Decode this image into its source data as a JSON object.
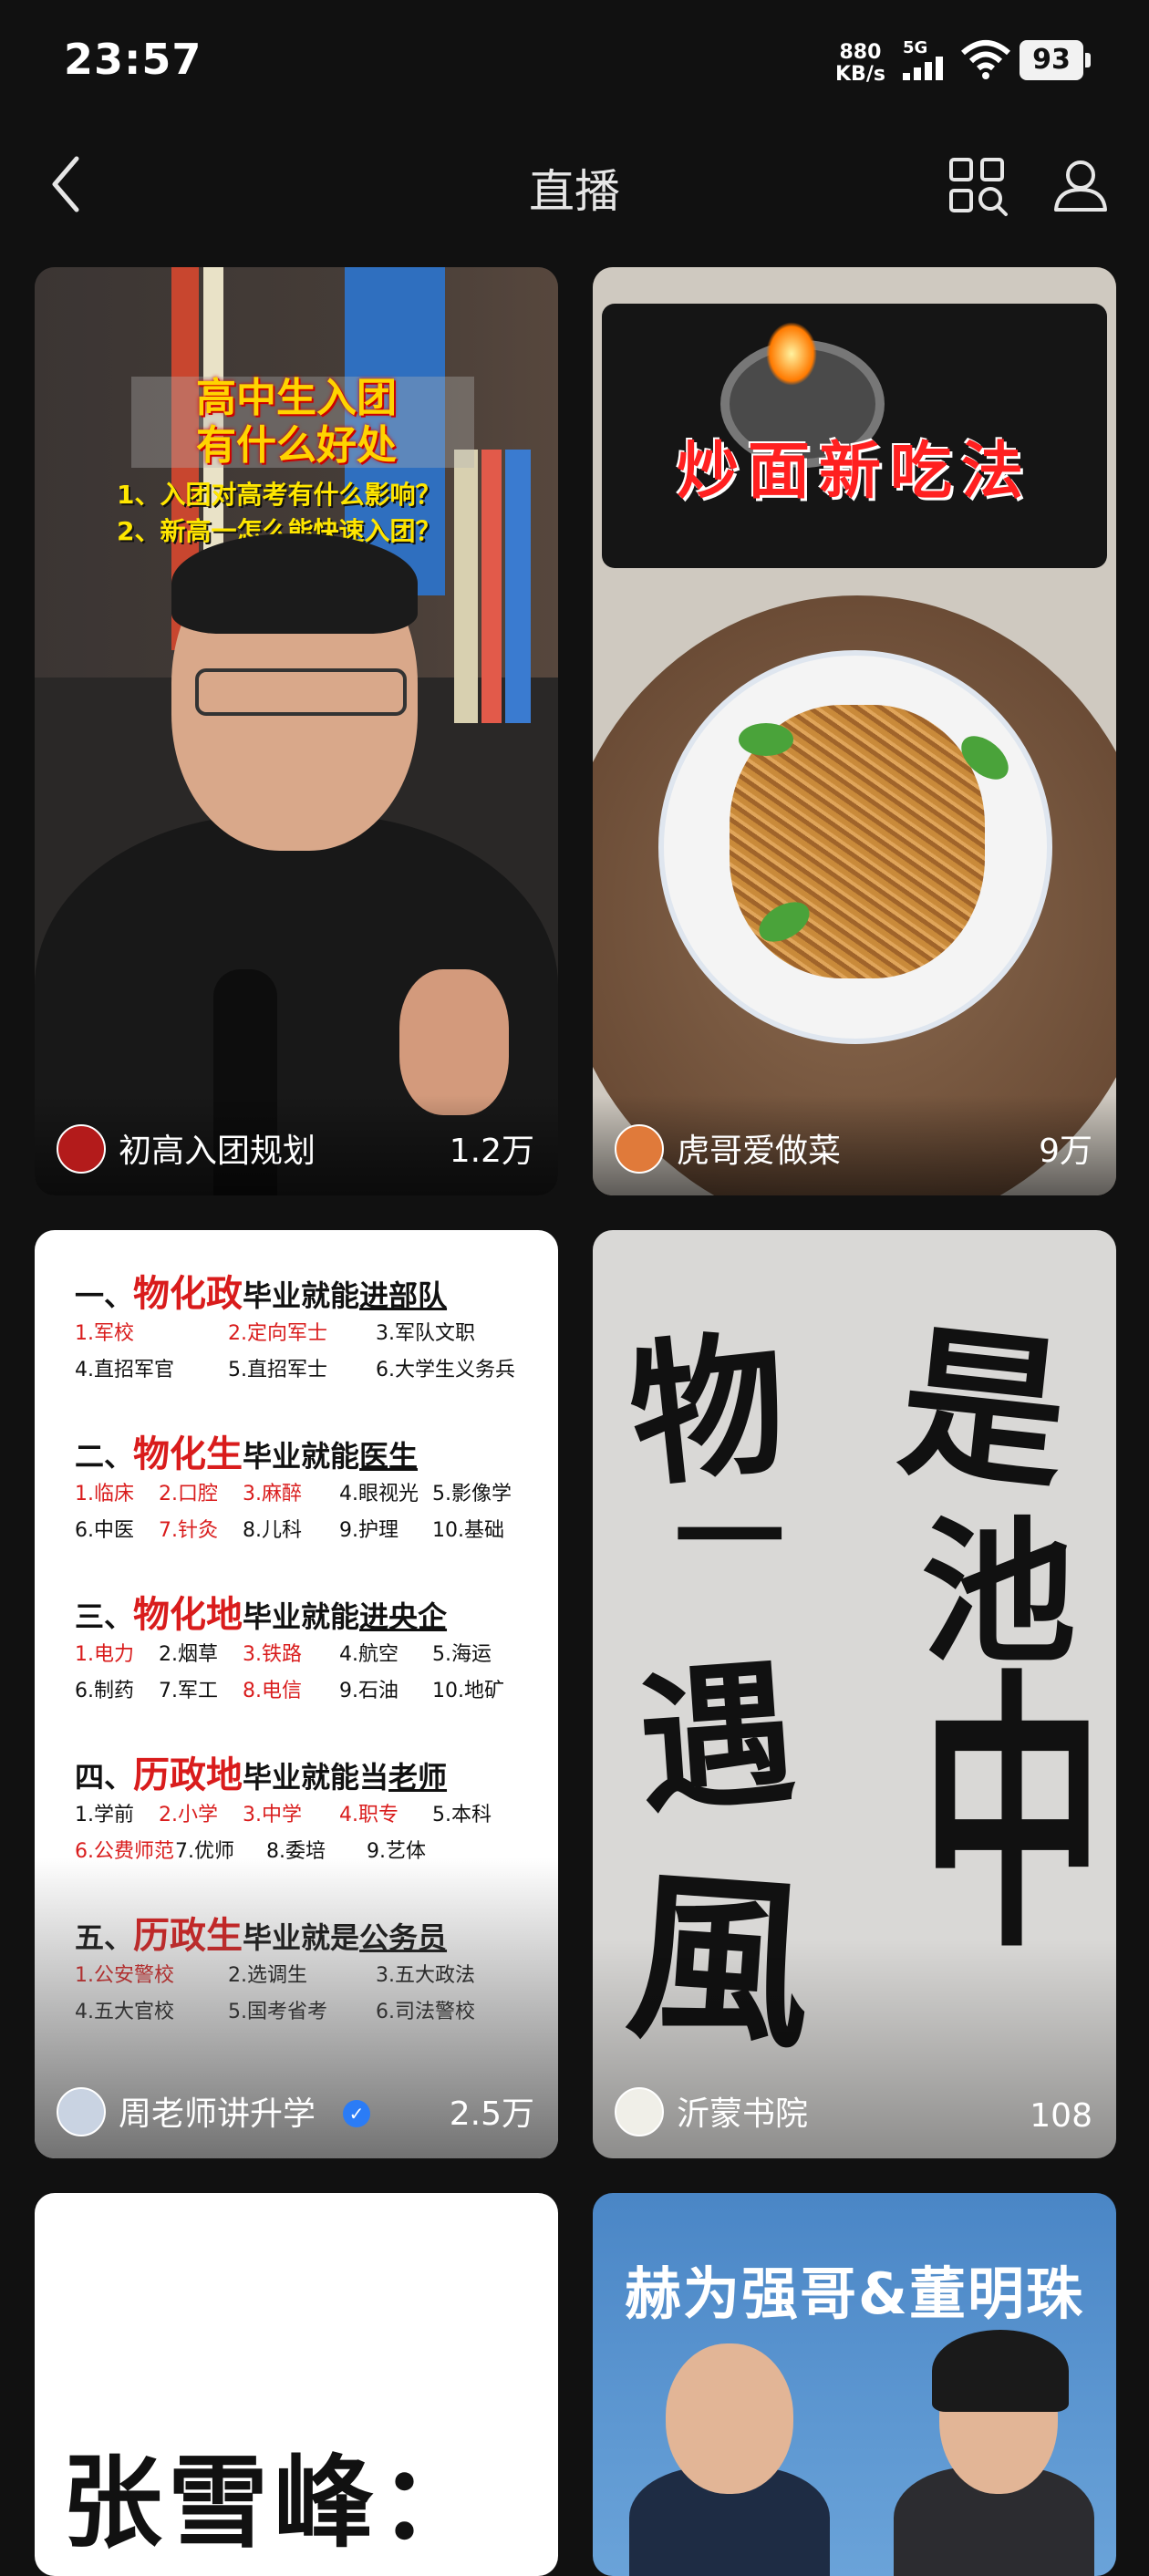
{
  "status_bar": {
    "time": "23:57",
    "net_speed_value": "880",
    "net_speed_unit": "KB/s",
    "network_type": "5G",
    "battery": "93"
  },
  "header": {
    "title": "直播"
  },
  "cards": [
    {
      "name": "初高入团规划",
      "count": "1.2万",
      "thumb": {
        "title_line1": "高中生入团",
        "title_line2": "有什么好处",
        "point1": "1、入团对高考有什么影响？",
        "point2": "2、新高一怎么能快速入团？"
      }
    },
    {
      "name": "虎哥爱做菜",
      "count": "9万",
      "thumb": {
        "title": "炒面新吃法"
      }
    },
    {
      "name": "周老师讲升学",
      "count": "2.5万",
      "verified": true,
      "thumb": {
        "sections": [
          {
            "num": "一、",
            "subject": "物化政",
            "mid": "毕业就能",
            "goal": "进部队",
            "rows": [
              [
                {
                  "t": "1.军校",
                  "red": true
                },
                {
                  "t": "2.定向军士",
                  "red": true
                },
                {
                  "t": "3.军队文职",
                  "red": false
                }
              ],
              [
                {
                  "t": "4.直招军官",
                  "red": false
                },
                {
                  "t": "5.直招军士",
                  "red": false
                },
                {
                  "t": "6.大学生义务兵",
                  "red": false
                }
              ]
            ]
          },
          {
            "num": "二、",
            "subject": "物化生",
            "mid": "毕业就能",
            "goal": "医生",
            "rows": [
              [
                {
                  "t": "1.临床",
                  "red": true
                },
                {
                  "t": "2.口腔",
                  "red": true
                },
                {
                  "t": "3.麻醉",
                  "red": true
                },
                {
                  "t": "4.眼视光",
                  "red": false
                },
                {
                  "t": "5.影像学",
                  "red": false
                }
              ],
              [
                {
                  "t": "6.中医",
                  "red": false
                },
                {
                  "t": "7.针灸",
                  "red": true
                },
                {
                  "t": "8.儿科",
                  "red": false
                },
                {
                  "t": "9.护理",
                  "red": false
                },
                {
                  "t": "10.基础",
                  "red": false
                }
              ]
            ]
          },
          {
            "num": "三、",
            "subject": "物化地",
            "mid": "毕业就能",
            "goal": "进央企",
            "rows": [
              [
                {
                  "t": "1.电力",
                  "red": true
                },
                {
                  "t": "2.烟草",
                  "red": false
                },
                {
                  "t": "3.铁路",
                  "red": true
                },
                {
                  "t": "4.航空",
                  "red": false
                },
                {
                  "t": "5.海运",
                  "red": false
                }
              ],
              [
                {
                  "t": "6.制药",
                  "red": false
                },
                {
                  "t": "7.军工",
                  "red": false
                },
                {
                  "t": "8.电信",
                  "red": true
                },
                {
                  "t": "9.石油",
                  "red": false
                },
                {
                  "t": "10.地矿",
                  "red": false
                }
              ]
            ]
          },
          {
            "num": "四、",
            "subject": "历政地",
            "mid": "毕业就能当",
            "goal": "老师",
            "rows": [
              [
                {
                  "t": "1.学前",
                  "red": false
                },
                {
                  "t": "2.小学",
                  "red": true
                },
                {
                  "t": "3.中学",
                  "red": true
                },
                {
                  "t": "4.职专",
                  "red": true
                },
                {
                  "t": "5.本科",
                  "red": false
                }
              ],
              [
                {
                  "t": "6.公费师范",
                  "red": true
                },
                {
                  "t": "7.优师",
                  "red": false
                },
                {
                  "t": "8.委培",
                  "red": false
                },
                {
                  "t": "9.艺体",
                  "red": false
                }
              ]
            ]
          },
          {
            "num": "五、",
            "subject": "历政生",
            "mid": "毕业就是",
            "goal": "公务员",
            "rows": [
              [
                {
                  "t": "1.公安警校",
                  "red": true
                },
                {
                  "t": "2.选调生",
                  "red": false
                },
                {
                  "t": "3.五大政法",
                  "red": false
                }
              ],
              [
                {
                  "t": "4.五大官校",
                  "red": false
                },
                {
                  "t": "5.国考省考",
                  "red": false
                },
                {
                  "t": "6.司法警校",
                  "red": false
                }
              ]
            ]
          }
        ]
      }
    },
    {
      "name": "沂蒙书院",
      "count": "108",
      "thumb": {
        "calligraphy": [
          "物",
          "一",
          "遇",
          "風",
          "是",
          "池",
          "中"
        ]
      }
    },
    {
      "name": "",
      "count": "",
      "thumb": {
        "title": "张雪峰："
      }
    },
    {
      "name": "",
      "count": "",
      "thumb": {
        "title": "赫为强哥&董明珠"
      }
    }
  ],
  "colors": {
    "background": "#111111",
    "accent_red": "#d91c1c",
    "verified_blue": "#2b7cf6",
    "thumb_yellow": "#ffd400"
  },
  "icons": [
    "back-arrow-icon",
    "scan-grid-icon",
    "user-icon",
    "signal-icon",
    "wifi-icon",
    "battery-icon",
    "verified-icon"
  ]
}
